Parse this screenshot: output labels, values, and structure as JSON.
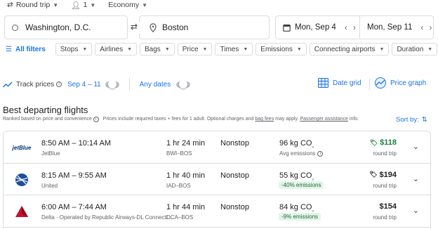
{
  "selectors": {
    "trip_type": "Round trip",
    "passengers": "1",
    "cabin": "Economy"
  },
  "search": {
    "origin": "Washington, D.C.",
    "destination": "Boston",
    "depart_date": "Mon, Sep 4",
    "return_date": "Mon, Sep 11"
  },
  "filters": {
    "all_filters_label": "All filters",
    "chips": [
      "Stops",
      "Airlines",
      "Bags",
      "Price",
      "Times",
      "Emissions",
      "Connecting airports",
      "Duration"
    ]
  },
  "tracking": {
    "track_label": "Track prices",
    "track_range": "Sep 4 – 11",
    "any_dates_label": "Any dates",
    "date_grid_label": "Date grid",
    "price_graph_label": "Price graph"
  },
  "section": {
    "title": "Best departing flights",
    "subtitle_part1": "Ranked based on price and convenience",
    "subtitle_part2": "Prices include required taxes + fees for 1 adult. Optional charges and",
    "bag_fees": "bag fees",
    "subtitle_part3": "may apply.",
    "passenger_assistance": "Passenger assistance",
    "subtitle_part4": "info.",
    "sort_label": "Sort by:"
  },
  "flights": [
    {
      "airline_logo": "jetblue-logo",
      "logo_text": "jetBlue",
      "times": "8:50 AM – 10:14 AM",
      "airline": "JetBlue",
      "duration": "1 hr 24 min",
      "route": "BWI–BOS",
      "stops": "Nonstop",
      "emissions": "96 kg CO",
      "emissions_sub": "₂",
      "emissions_note": "Avg emissions",
      "emissions_badge": "",
      "price": "$118",
      "price_color": "#188038",
      "trip": "round trip"
    },
    {
      "airline_logo": "united-logo",
      "logo_text": "",
      "times": "8:15 AM – 9:55 AM",
      "airline": "United",
      "duration": "1 hr 40 min",
      "route": "IAD–BOS",
      "stops": "Nonstop",
      "emissions": "55 kg CO",
      "emissions_sub": "₂",
      "emissions_note": "",
      "emissions_badge": "-40% emissions",
      "price": "$194",
      "price_color": "#202124",
      "trip": "round trip"
    },
    {
      "airline_logo": "delta-logo",
      "logo_text": "",
      "times": "6:00 AM – 7:44 AM",
      "airline": "Delta · Operated by Republic Airways-DL Connecti…",
      "duration": "1 hr 44 min",
      "route": "DCA–BOS",
      "stops": "Nonstop",
      "emissions": "84 kg CO",
      "emissions_sub": "₂",
      "emissions_note": "",
      "emissions_badge": "-9% emissions",
      "price": "$154",
      "price_color": "#202124",
      "trip": "round trip"
    }
  ]
}
